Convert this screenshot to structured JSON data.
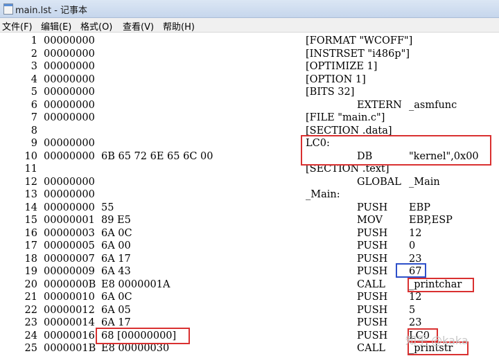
{
  "window": {
    "title": "main.lst - 记事本"
  },
  "menu": [
    "文件(F)",
    "编辑(E)",
    "格式(O)",
    "查看(V)",
    "帮助(H)"
  ],
  "lines": [
    {
      "n": "1",
      "addr": "00000000",
      "hex": "",
      "label": "[FORMAT \"WCOFF\"]",
      "op": "",
      "arg": ""
    },
    {
      "n": "2",
      "addr": "00000000",
      "hex": "",
      "label": "[INSTRSET \"i486p\"]",
      "op": "",
      "arg": ""
    },
    {
      "n": "3",
      "addr": "00000000",
      "hex": "",
      "label": "[OPTIMIZE 1]",
      "op": "",
      "arg": ""
    },
    {
      "n": "4",
      "addr": "00000000",
      "hex": "",
      "label": "[OPTION 1]",
      "op": "",
      "arg": ""
    },
    {
      "n": "5",
      "addr": "00000000",
      "hex": "",
      "label": "[BITS 32]",
      "op": "",
      "arg": ""
    },
    {
      "n": "6",
      "addr": "00000000",
      "hex": "",
      "label": "",
      "op": "EXTERN",
      "arg": "_asmfunc"
    },
    {
      "n": "7",
      "addr": "00000000",
      "hex": "",
      "label": "[FILE \"main.c\"]",
      "op": "",
      "arg": ""
    },
    {
      "n": "8",
      "addr": "",
      "hex": "",
      "label": "[SECTION .data]",
      "op": "",
      "arg": ""
    },
    {
      "n": "9",
      "addr": "00000000",
      "hex": "",
      "label": "LC0:",
      "op": "",
      "arg": ""
    },
    {
      "n": "10",
      "addr": "00000000",
      "hex": "6B 65 72 6E 65 6C 00",
      "label": "",
      "op": "DB",
      "arg": "\"kernel\",0x00"
    },
    {
      "n": "11",
      "addr": "",
      "hex": "",
      "label": "[SECTION .text]",
      "op": "",
      "arg": ""
    },
    {
      "n": "12",
      "addr": "00000000",
      "hex": "",
      "label": "",
      "op": "GLOBAL",
      "arg": "_Main"
    },
    {
      "n": "13",
      "addr": "00000000",
      "hex": "",
      "label": "_Main:",
      "op": "",
      "arg": ""
    },
    {
      "n": "14",
      "addr": "00000000",
      "hex": "55",
      "label": "",
      "op": "PUSH",
      "arg": "EBP"
    },
    {
      "n": "15",
      "addr": "00000001",
      "hex": "89 E5",
      "label": "",
      "op": "MOV",
      "arg": "EBP,ESP"
    },
    {
      "n": "16",
      "addr": "00000003",
      "hex": "6A 0C",
      "label": "",
      "op": "PUSH",
      "arg": "12"
    },
    {
      "n": "17",
      "addr": "00000005",
      "hex": "6A 00",
      "label": "",
      "op": "PUSH",
      "arg": "0"
    },
    {
      "n": "18",
      "addr": "00000007",
      "hex": "6A 17",
      "label": "",
      "op": "PUSH",
      "arg": "23"
    },
    {
      "n": "19",
      "addr": "00000009",
      "hex": "6A 43",
      "label": "",
      "op": "PUSH",
      "arg": "67"
    },
    {
      "n": "20",
      "addr": "0000000B",
      "hex": "E8 0000001A",
      "label": "",
      "op": "CALL",
      "arg": "_printchar"
    },
    {
      "n": "21",
      "addr": "00000010",
      "hex": "6A 0C",
      "label": "",
      "op": "PUSH",
      "arg": "12"
    },
    {
      "n": "22",
      "addr": "00000012",
      "hex": "6A 05",
      "label": "",
      "op": "PUSH",
      "arg": "5"
    },
    {
      "n": "23",
      "addr": "00000014",
      "hex": "6A 17",
      "label": "",
      "op": "PUSH",
      "arg": "23"
    },
    {
      "n": "24",
      "addr": "00000016",
      "hex": "68 [00000000]",
      "label": "",
      "op": "PUSH",
      "arg": "LC0"
    },
    {
      "n": "25",
      "addr": "0000001B",
      "hex": "E8 00000030",
      "label": "",
      "op": "CALL",
      "arg": "_printstr"
    }
  ],
  "colors": {
    "highlight_red": "#d93030",
    "highlight_blue": "#2d4fc9"
  },
  "watermark": "知乎 @kaka"
}
